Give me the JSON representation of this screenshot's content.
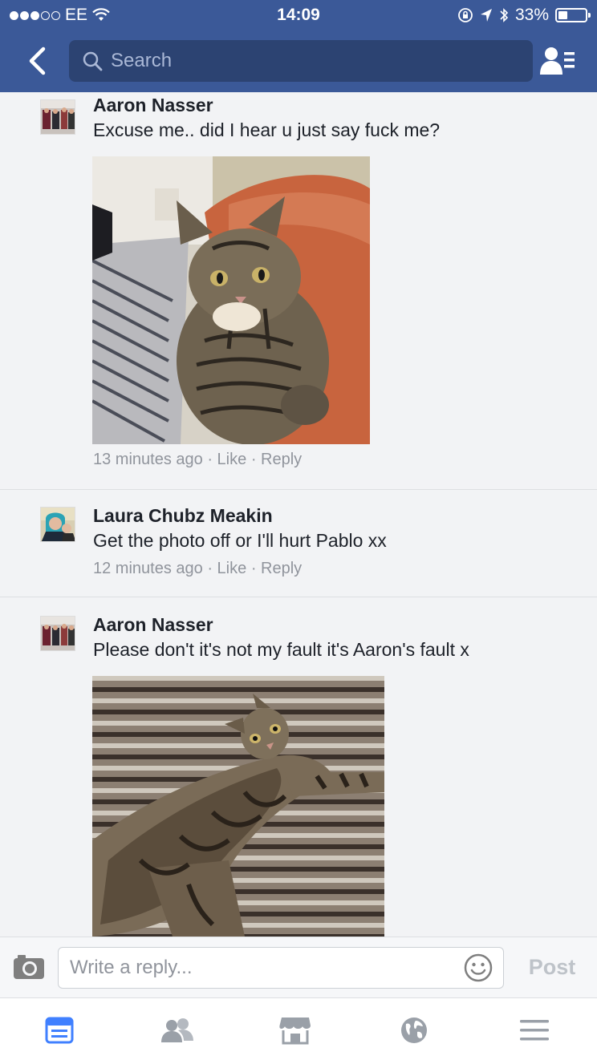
{
  "status_bar": {
    "carrier": "EE",
    "time": "14:09",
    "battery": "33%",
    "battery_level": 0.33
  },
  "header": {
    "search_placeholder": "Search"
  },
  "comments": [
    {
      "author": "Aaron Nasser",
      "text": "Excuse me.. did I hear u just say fuck me?",
      "time": "13 minutes ago",
      "like": "Like",
      "reply": "Reply",
      "has_photo": true
    },
    {
      "author": "Laura Chubz Meakin",
      "text": "Get the photo off or I'll hurt Pablo xx",
      "time": "12 minutes ago",
      "like": "Like",
      "reply": "Reply",
      "has_photo": false
    },
    {
      "author": "Aaron Nasser",
      "text": "Please don't it's not my fault it's Aaron's fault x",
      "has_photo": true
    }
  ],
  "reply_bar": {
    "placeholder": "Write a reply...",
    "post_label": "Post"
  },
  "tab_bar": {
    "tabs": [
      "news-feed-icon",
      "friends-icon",
      "marketplace-icon",
      "notifications-globe-icon",
      "menu-icon"
    ]
  },
  "colors": {
    "brand_blue": "#3b5998",
    "active_tab": "#4080ff"
  }
}
